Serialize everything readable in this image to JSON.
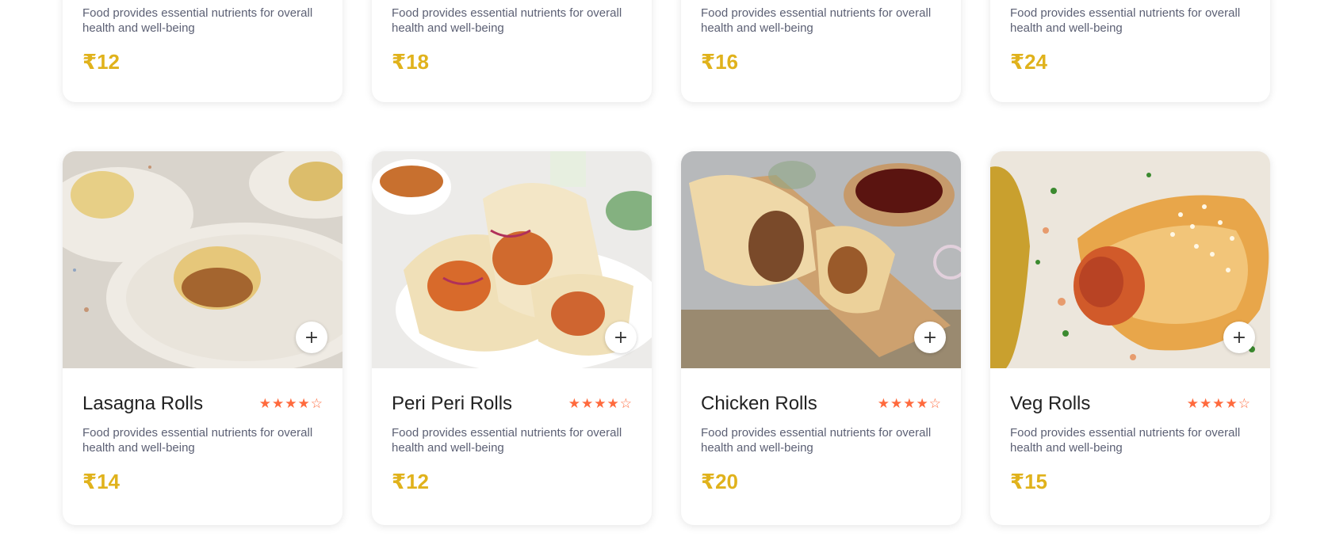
{
  "top_cards": [
    {
      "desc": "Food provides essential nutrients for overall health and well-being",
      "price": "₹12"
    },
    {
      "desc": "Food provides essential nutrients for overall health and well-being",
      "price": "₹18"
    },
    {
      "desc": "Food provides essential nutrients for overall health and well-being",
      "price": "₹16"
    },
    {
      "desc": "Food provides essential nutrients for overall health and well-being",
      "price": "₹24"
    }
  ],
  "cards": [
    {
      "title": "Lasagna Rolls",
      "desc": "Food provides essential nutrients for overall health and well-being",
      "price": "₹14",
      "rating": 4,
      "max_rating": 5,
      "add_label": "+"
    },
    {
      "title": "Peri Peri Rolls",
      "desc": "Food provides essential nutrients for overall health and well-being",
      "price": "₹12",
      "rating": 4,
      "max_rating": 5,
      "add_label": "+"
    },
    {
      "title": "Chicken Rolls",
      "desc": "Food provides essential nutrients for overall health and well-being",
      "price": "₹20",
      "rating": 4,
      "max_rating": 5,
      "add_label": "+"
    },
    {
      "title": "Veg Rolls",
      "desc": "Food provides essential nutrients for overall health and well-being",
      "price": "₹15",
      "rating": 4,
      "max_rating": 5,
      "add_label": "+"
    }
  ],
  "colors": {
    "price": "#e0b21c",
    "star": "#ff6a3d",
    "text": "#5c6074"
  },
  "icons": {
    "star_filled": "star-filled-icon",
    "star_empty": "star-empty-icon",
    "add": "plus-icon"
  }
}
